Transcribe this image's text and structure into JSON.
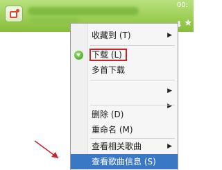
{
  "header": {
    "time": "00:",
    "download_icon": "download-icon",
    "star_icon": "star-icon"
  },
  "menu": {
    "items": [
      {
        "label": "收藏到 (T)",
        "submenu": true
      },
      {
        "label": "下载 (L)",
        "submenu": false
      },
      {
        "label": "多首下载",
        "submenu": false
      },
      {
        "label": "",
        "submenu": true
      },
      {
        "label": "",
        "submenu": true
      },
      {
        "label": "删除 (D)",
        "submenu": false
      },
      {
        "label": "重命名 (M)",
        "submenu": false
      },
      {
        "label": "查看相关歌曲",
        "submenu": true
      },
      {
        "label": "查看歌曲信息 (S)",
        "submenu": false
      }
    ],
    "highlight_color": "#3a78c6",
    "annotation_color": "#c8232b"
  }
}
